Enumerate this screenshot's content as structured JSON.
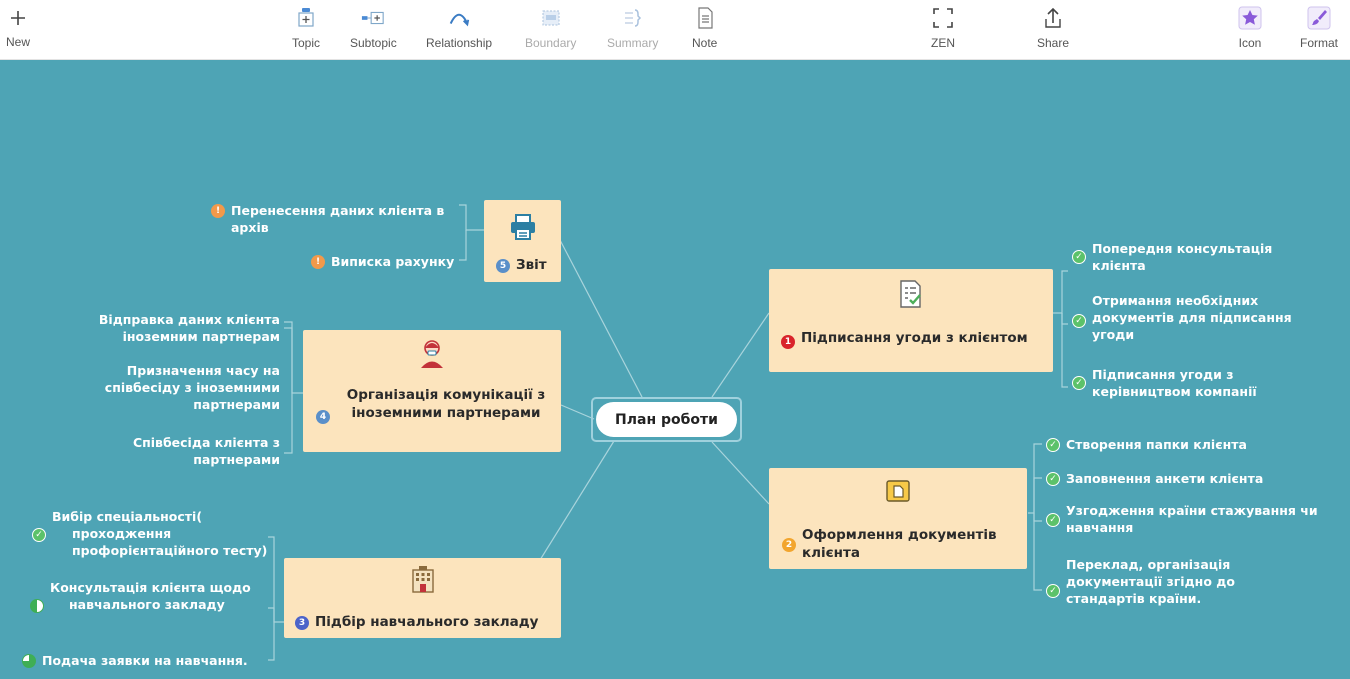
{
  "toolbar": {
    "new": "New",
    "topic": "Topic",
    "subtopic": "Subtopic",
    "relationship": "Relationship",
    "boundary": "Boundary",
    "summary": "Summary",
    "note": "Note",
    "zen": "ZEN",
    "share": "Share",
    "icon": "Icon",
    "format": "Format"
  },
  "colors": {
    "canvas": "#4ea4b5",
    "topic_fill": "#fce4bd",
    "central_border": "#9fd1dd",
    "connector": "#a9d4dc"
  },
  "mindmap": {
    "central": "План роботи",
    "topics": {
      "t1": {
        "number": "1",
        "icon": "checklist-icon",
        "title": "Підписання угоди з клієнтом",
        "children": [
          {
            "text": "Попередня консультація клієнта",
            "marker": "check"
          },
          {
            "text": "Отримання необхідних документів для підписання угоди",
            "marker": "check"
          },
          {
            "text": "Підписання угоди з керівництвом компанії",
            "marker": "check"
          }
        ]
      },
      "t2": {
        "number": "2",
        "icon": "folder-icon",
        "title": "Оформлення документів клієнта",
        "children": [
          {
            "text": "Створення папки клієнта",
            "marker": "check"
          },
          {
            "text": "Заповнення анкети клієнта",
            "marker": "check"
          },
          {
            "text": "Узгодження країни стажування чи навчання",
            "marker": "check"
          },
          {
            "text": "Переклад, організація документації згідно до стандартів країни.",
            "marker": "check"
          }
        ]
      },
      "t3": {
        "number": "3",
        "icon": "building-icon",
        "title": "Підбір навчального закладу",
        "children": [
          {
            "text": "Вибір спеціальності( проходження профорієнтаційного тесту)",
            "marker": "check"
          },
          {
            "text": "Консультація клієнта щодо навчального закладу",
            "marker": "half"
          },
          {
            "text": "Подача заявки на навчання.",
            "marker": "three-quarter"
          }
        ]
      },
      "t4": {
        "number": "4",
        "icon": "person-icon",
        "title": "Організація комунікації з іноземними партнерами",
        "children": [
          {
            "text": "Відправка даних клієнта іноземним партнерам",
            "marker": "none"
          },
          {
            "text": "Призначення часу на співбесіду з іноземними партнерами",
            "marker": "none"
          },
          {
            "text": "Співбесіда клієнта з партнерами",
            "marker": "none"
          }
        ]
      },
      "t5": {
        "number": "5",
        "icon": "printer-icon",
        "title": "Звіт",
        "children": [
          {
            "text": "Перенесення даних клієнта в архів",
            "marker": "warning"
          },
          {
            "text": "Виписка рахунку",
            "marker": "warning"
          }
        ]
      }
    }
  }
}
